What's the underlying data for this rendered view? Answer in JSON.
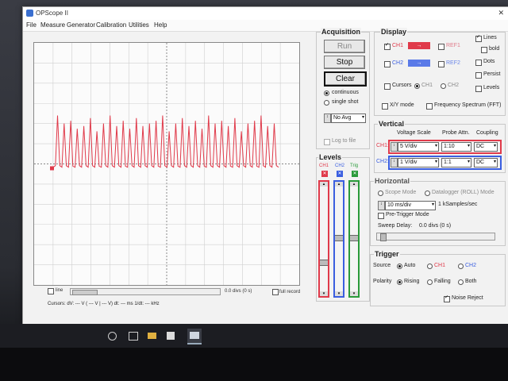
{
  "window": {
    "title": "OPScope II"
  },
  "menu": [
    "File",
    "Measure",
    "Generator",
    "Calibration",
    "Utilities",
    "Help"
  ],
  "acquisition": {
    "title": "Acquisition",
    "run": "Run",
    "stop": "Stop",
    "clear": "Clear",
    "continuous": "continuous",
    "single_shot": "single shot",
    "avg": "No Avg",
    "log_to_file": "Log to file"
  },
  "display": {
    "title": "Display",
    "ch1": "CH1",
    "ch2": "CH2",
    "ref1": "REF1",
    "ref2": "REF2",
    "lines": "Lines",
    "bold": "bold",
    "dots": "Dots",
    "persist": "Persist",
    "levels": "Levels",
    "cursors": "Cursors",
    "cursor_ch1": "CH1",
    "cursor_ch2": "CH2",
    "xy_mode": "X/Y mode",
    "fft": "Frequency Spectrum (FFT)",
    "ch1_color": "#e03a4a",
    "ch2_color": "#3a5ee0"
  },
  "vertical": {
    "title": "Vertical",
    "h_voltage": "Voltage Scale",
    "h_probe": "Probe Attn.",
    "h_coupling": "Coupling",
    "ch1_label": "CH1:",
    "ch1_scale": "5 V/div",
    "ch1_probe": "1:10",
    "ch1_coupling": "DC",
    "ch2_label": "CH2:",
    "ch2_scale": "1 V/div",
    "ch2_probe": "1:1",
    "ch2_coupling": "DC"
  },
  "horizontal": {
    "title": "Horizontal",
    "scope_mode": "Scope Mode",
    "datalogger": "Datalogger (ROLL) Mode",
    "timebase": "10 ms/div",
    "samples": "1 kSamples/sec",
    "pretrigger": "Pre-Trigger Mode",
    "sweep_label": "Sweep Delay:",
    "sweep_value": "0.0 divs (0 s)"
  },
  "trigger": {
    "title": "Trigger",
    "source": "Source",
    "auto": "Auto",
    "ch1": "CH1",
    "ch2": "CH2",
    "polarity": "Polarity",
    "rising": "Rising",
    "falling": "Falling",
    "both": "Both",
    "noise_reject": "Noise Reject"
  },
  "levels": {
    "title": "Levels",
    "ch1": "CH1",
    "ch2": "CH2",
    "trig": "Trig",
    "ch1_level": 0.25,
    "ch2_level": 0.5,
    "trig_level": 0.5
  },
  "scope": {
    "line_label": "line",
    "offset_text": "0.0 divs (0 s)",
    "full_record": "full record",
    "cursors_text": "Cursors: dV: --- V  ( --- V | --- V)      dt: --- ms      1/dt: --- kHz",
    "trace_color": "#e03a4a",
    "grid_divs_x": 14,
    "grid_divs_y": 12
  },
  "chart_data": {
    "type": "line",
    "series": [
      {
        "values": [
          0.02,
          0.05,
          1.0,
          0.05,
          0.02,
          0.85,
          0.05,
          0.02,
          0.9,
          0.04,
          0.02,
          0.75,
          0.05,
          0.02,
          0.8,
          0.05,
          0.02,
          0.95,
          0.05,
          0.02,
          0.7,
          0.04,
          0.02,
          0.85,
          0.05,
          0.02,
          1.0,
          0.05,
          0.02,
          0.8,
          0.05,
          0.02,
          0.9,
          0.04,
          0.02,
          0.75,
          0.05,
          0.02,
          0.95,
          0.05,
          0.02,
          0.8,
          0.05,
          0.02,
          0.85,
          0.05,
          0.02,
          0.9,
          0.04,
          0.02,
          1.0,
          0.05,
          0.02,
          0.7,
          0.05,
          0.02,
          0.85,
          0.04,
          0.02,
          0.95,
          0.05,
          0.02,
          0.8,
          0.05,
          0.02,
          0.9,
          0.05,
          0.02,
          0.75,
          0.04,
          0.02,
          1.0,
          0.05,
          0.02,
          0.85,
          0.05,
          0.02,
          0.9,
          0.05,
          0.02,
          0.8,
          0.04,
          0.02,
          0.95,
          0.05,
          0.02,
          0.7,
          0.05,
          0.02,
          0.85,
          0.05,
          0.02,
          0.9,
          0.04,
          0.02,
          1.0,
          0.05,
          0.02,
          0.8,
          0.05,
          0.02,
          0.85,
          0.05,
          0.02
        ]
      }
    ],
    "title": "",
    "xlabel": "",
    "ylabel": "",
    "ylim": [
      0,
      1
    ],
    "grid": true
  }
}
